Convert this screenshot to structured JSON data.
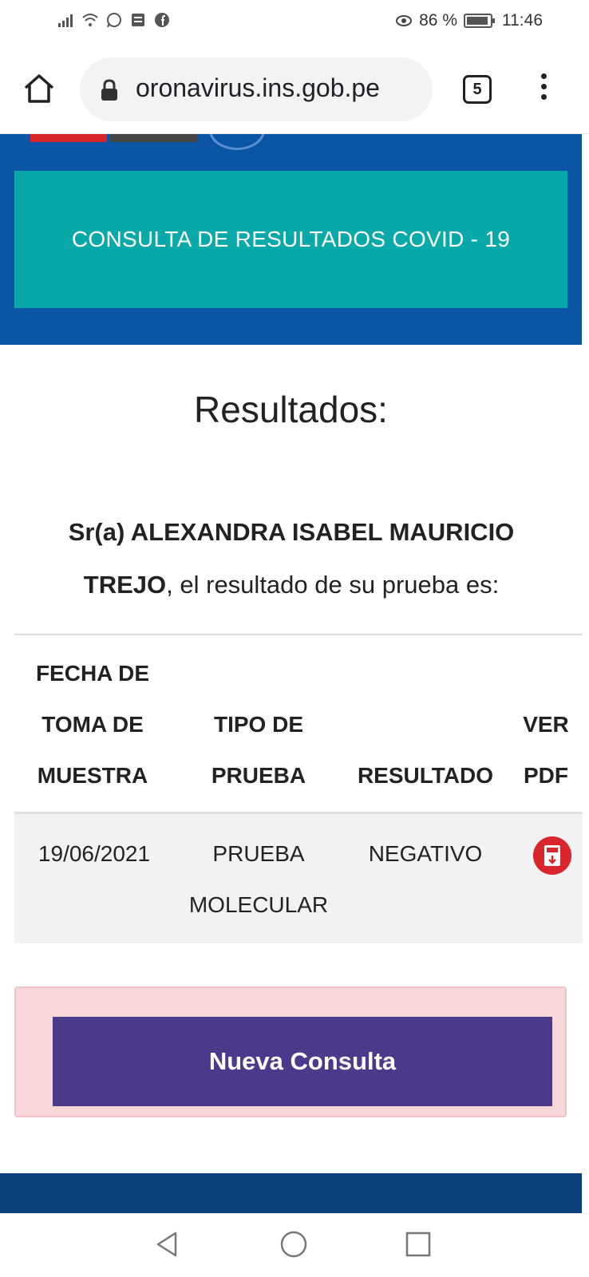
{
  "status_bar": {
    "left_icons": [
      "signal-icon",
      "wifi-icon",
      "whatsapp-icon",
      "message-icon",
      "facebook-icon"
    ],
    "eye_icon": "eye-icon",
    "battery_percent": "86 %",
    "battery_icon": "battery-icon",
    "time": "11:46"
  },
  "browser": {
    "url": "oronavirus.ins.gob.pe",
    "tab_count": "5"
  },
  "header": {
    "banner_title": "CONSULTA DE RESULTADOS COVID - 19"
  },
  "main": {
    "title": "Resultados:",
    "greeting_prefix": "Sr(a) ALEXANDRA ISABEL MAURICIO TREJO",
    "greeting_suffix": ", el resultado de su prueba es:"
  },
  "table": {
    "headers": {
      "fecha_line1": "FECHA DE",
      "fecha_line2": "TOMA DE",
      "fecha_line3": "MUESTRA",
      "tipo_line1": "TIPO DE",
      "tipo_line2": "PRUEBA",
      "resultado": "RESULTADO",
      "pdf_line1": "VER",
      "pdf_line2": "PDF"
    },
    "rows": [
      {
        "fecha": "19/06/2021",
        "tipo_line1": "PRUEBA",
        "tipo_line2": "MOLECULAR",
        "resultado": "NEGATIVO",
        "pdf_icon": "pdf-download-icon"
      }
    ]
  },
  "actions": {
    "nueva_consulta_label": "Nueva Consulta"
  },
  "colors": {
    "header_blue": "#0a55a5",
    "banner_teal": "#0aa9a9",
    "button_purple": "#4b3a8c",
    "alert_pink": "#f8d7da",
    "pdf_red": "#d9262c"
  }
}
